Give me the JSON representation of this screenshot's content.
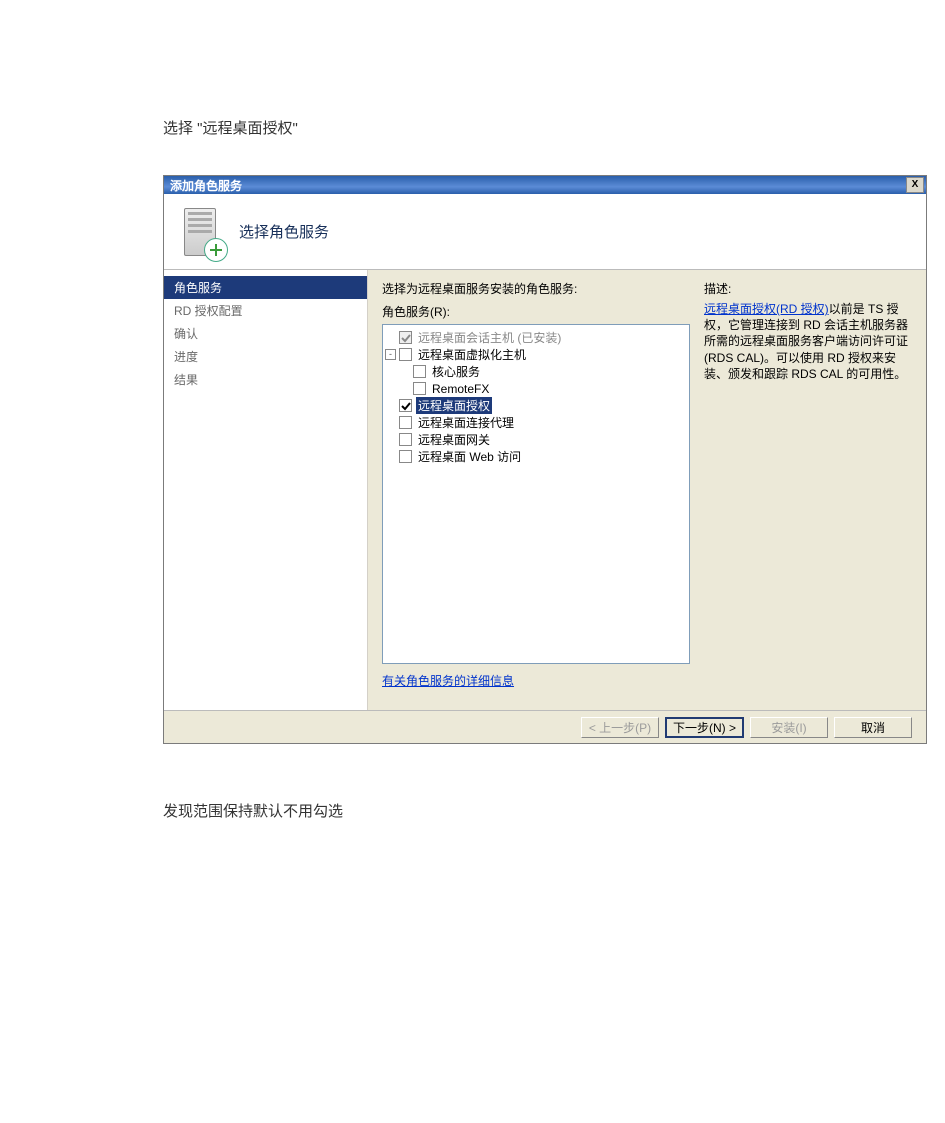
{
  "doc": {
    "line1": "选择 \"远程桌面授权\"",
    "line2": "发现范围保持默认不用勾选"
  },
  "window": {
    "title": "添加角色服务",
    "close": "X",
    "header": "选择角色服务",
    "sidebar": [
      {
        "label": "角色服务",
        "active": true
      },
      {
        "label": "RD 授权配置",
        "active": false
      },
      {
        "label": "确认",
        "active": false
      },
      {
        "label": "进度",
        "active": false
      },
      {
        "label": "结果",
        "active": false
      }
    ],
    "instruction": "选择为远程桌面服务安装的角色服务:",
    "tree_label": "角色服务(R):",
    "tree": [
      {
        "indent": 1,
        "expander": "",
        "checkbox": "checked-disabled",
        "text": "远程桌面会话主机  (已安装)",
        "disabled": true
      },
      {
        "indent": 0,
        "expander": "-",
        "checkbox": "unchecked",
        "text": "远程桌面虚拟化主机"
      },
      {
        "indent": 2,
        "expander": "",
        "checkbox": "unchecked",
        "text": "核心服务"
      },
      {
        "indent": 2,
        "expander": "",
        "checkbox": "unchecked",
        "text": "RemoteFX"
      },
      {
        "indent": 1,
        "expander": "",
        "checkbox": "checked",
        "text": "远程桌面授权",
        "selected": true
      },
      {
        "indent": 1,
        "expander": "",
        "checkbox": "unchecked",
        "text": "远程桌面连接代理"
      },
      {
        "indent": 1,
        "expander": "",
        "checkbox": "unchecked",
        "text": "远程桌面网关"
      },
      {
        "indent": 1,
        "expander": "",
        "checkbox": "unchecked",
        "text": "远程桌面 Web 访问"
      }
    ],
    "details_link": "有关角色服务的详细信息",
    "desc_head": "描述:",
    "desc_link": "远程桌面授权(RD 授权)",
    "desc_text": "以前是 TS 授权，它管理连接到 RD 会话主机服务器所需的远程桌面服务客户端访问许可证(RDS CAL)。可以使用 RD 授权来安装、颁发和跟踪 RDS CAL 的可用性。",
    "buttons": {
      "prev": "< 上一步(P)",
      "next": "下一步(N) >",
      "install": "安装(I)",
      "cancel": "取消"
    }
  }
}
